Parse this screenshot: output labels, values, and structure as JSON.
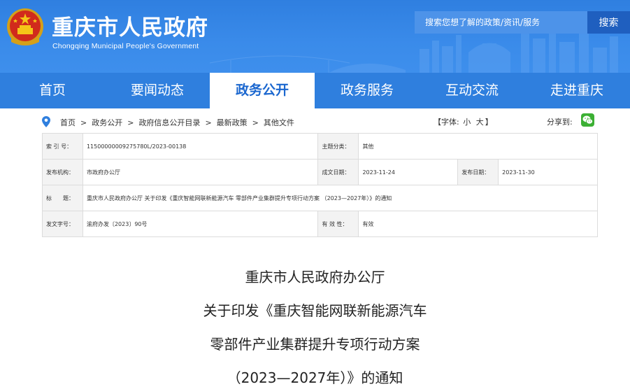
{
  "header": {
    "site_title": "重庆市人民政府",
    "site_subtitle": "Chongqing Municipal People's Government",
    "search_placeholder": "搜索您想了解的政策/资讯/服务",
    "search_button": "搜索",
    "brand_color": "#2f7fde"
  },
  "nav": {
    "items": [
      {
        "label": "首页"
      },
      {
        "label": "要闻动态"
      },
      {
        "label": "政务公开",
        "active": true
      },
      {
        "label": "政务服务"
      },
      {
        "label": "互动交流"
      },
      {
        "label": "走进重庆"
      }
    ]
  },
  "breadcrumb": {
    "items": [
      "首页",
      "政务公开",
      "政府信息公开目录",
      "最新政策",
      "其他文件"
    ],
    "separator": ">"
  },
  "font_size": {
    "prefix": "【字体:",
    "small": "小",
    "large": "大",
    "suffix": "】"
  },
  "share": {
    "label": "分享到:",
    "icon": "wechat-icon"
  },
  "meta": {
    "index_label": "索 引 号：",
    "index_value": "11500000009275780L/2023-00138",
    "topic_label": "主题分类：",
    "topic_value": "其他",
    "agency_label": "发布机构：",
    "agency_value": "市政府办公厅",
    "created_label": "成文日期：",
    "created_value": "2023-11-24",
    "published_label": "发布日期：",
    "published_value": "2023-11-30",
    "title_label": "标　　题：",
    "title_value": "重庆市人民政府办公厅 关于印发《重庆智能网联新能源汽车 零部件产业集群提升专项行动方案 （2023—2027年）》的通知",
    "docno_label": "发文字号：",
    "docno_value": "渝府办发〔2023〕90号",
    "validity_label": "有 效 性：",
    "validity_value": "有效"
  },
  "article": {
    "title_lines": [
      "重庆市人民政府办公厅",
      "关于印发《重庆智能网联新能源汽车",
      "零部件产业集群提升专项行动方案",
      "（2023—2027年）》的通知"
    ]
  }
}
